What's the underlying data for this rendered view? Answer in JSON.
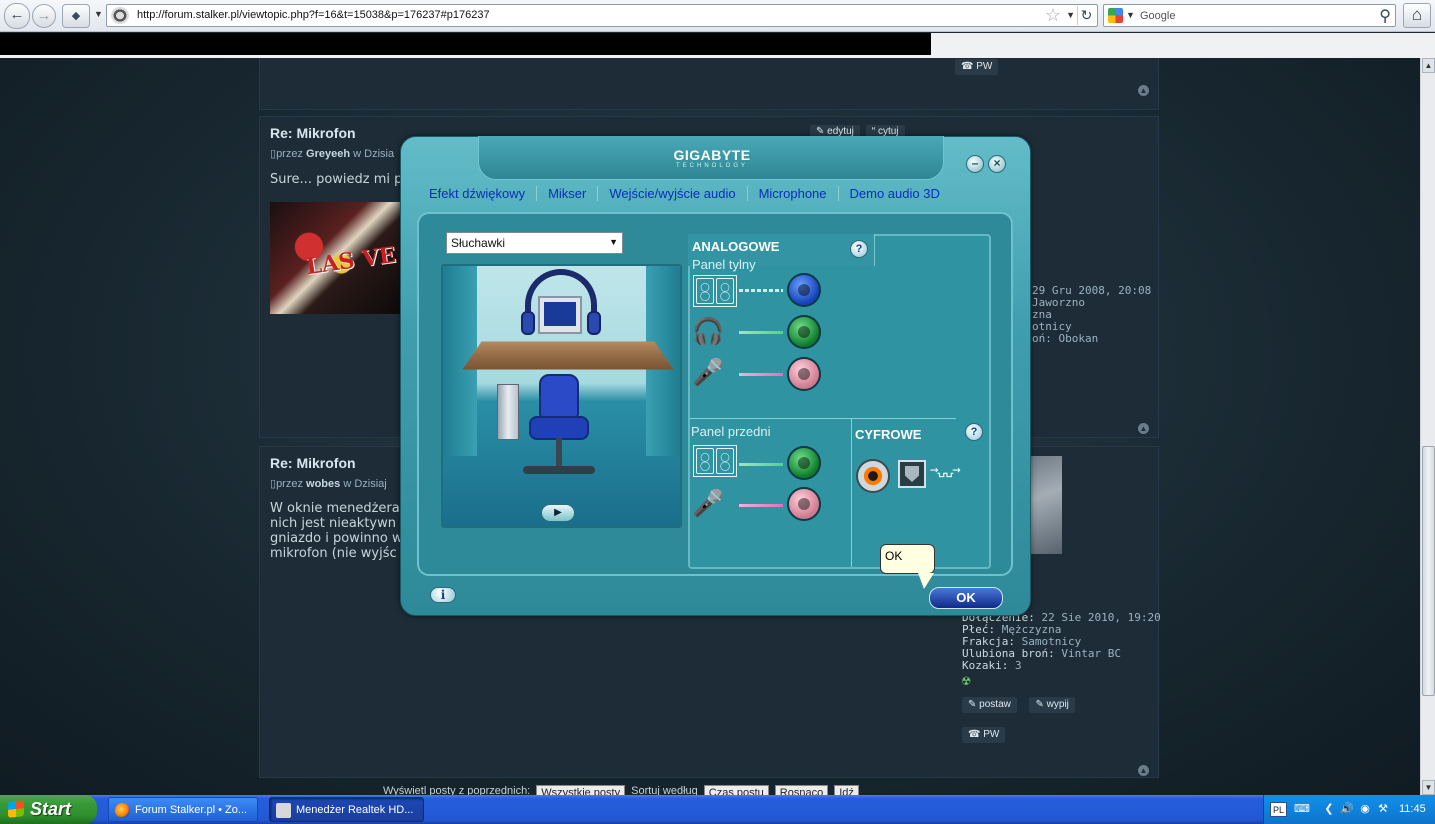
{
  "browser": {
    "url": "http://forum.stalker.pl/viewtopic.php?f=16&t=15038&p=176237#p176237",
    "search_placeholder": "Google"
  },
  "forum": {
    "top_pw": "PW",
    "post1": {
      "title": "Re: Mikrofon",
      "meta_prefix": "przez",
      "author": "Greyeeh",
      "meta_suffix": "w Dzisia",
      "body": "Sure... powiedz mi p",
      "action_edit": "edytuj",
      "action_quote": "cytuj",
      "sidebar_lines": [
        "29 Gru 2008, 20:08",
        "Jaworzno",
        "zna",
        "otnicy",
        "oń: Obokan"
      ],
      "vegas_text": "LAS VE"
    },
    "post2": {
      "title": "Re: Mikrofon",
      "meta_prefix": "przez",
      "author": "wobes",
      "meta_suffix": "w Dzisiaj",
      "body_lines": [
        "W oknie menedżera",
        "nich jest nieaktywn",
        "gniazdo i powinno w",
        "mikrofon (nie wyjśc"
      ],
      "sidebar": {
        "joined_label": "Dołączenie:",
        "joined_value": "22 Sie 2010, 19:20",
        "gender_label": "Płeć:",
        "gender_value": "Mężczyzna",
        "faction_label": "Frakcja:",
        "faction_value": "Samotnicy",
        "weapon_label": "Ulubiona broń:",
        "weapon_value": "Vintar BC",
        "kozaki_label": "Kozaki:",
        "kozaki_value": "3",
        "btn_postaw": "postaw",
        "btn_wypij": "wypij",
        "btn_pw": "PW"
      }
    },
    "bottom": {
      "label_show": "Wyświetl posty z poprzednich:",
      "sel_show": "Wszystkie posty",
      "label_sort": "Sortuj według",
      "sel_sort": "Czas postu",
      "sel_order": "Rosnąco",
      "go": "Idź"
    }
  },
  "dialog": {
    "brand": "GIGABYTE",
    "brand_sub": "TECHNOLOGY",
    "tabs": [
      "Efekt dźwiękowy",
      "Mikser",
      "Wejście/wyjście audio",
      "Microphone",
      "Demo audio 3D"
    ],
    "device_selected": "Słuchawki",
    "analog_title": "ANALOGOWE",
    "rear_panel_label": "Panel tylny",
    "front_panel_label": "Panel przedni",
    "digital_title": "CYFROWE",
    "help_glyph": "?",
    "info_glyph": "i",
    "ok_label": "OK",
    "tooltip_text": "OK",
    "jack_colors": {
      "blue": "#1340b8",
      "green": "#0e7a2a",
      "pink": "#d0788e",
      "spdif": "#ff7a00"
    }
  },
  "taskbar": {
    "start_label": "Start",
    "tasks": [
      "Forum Stalker.pl • Zo...",
      "Menedżer Realtek HD..."
    ],
    "lang": "PL",
    "clock": "11:45"
  }
}
